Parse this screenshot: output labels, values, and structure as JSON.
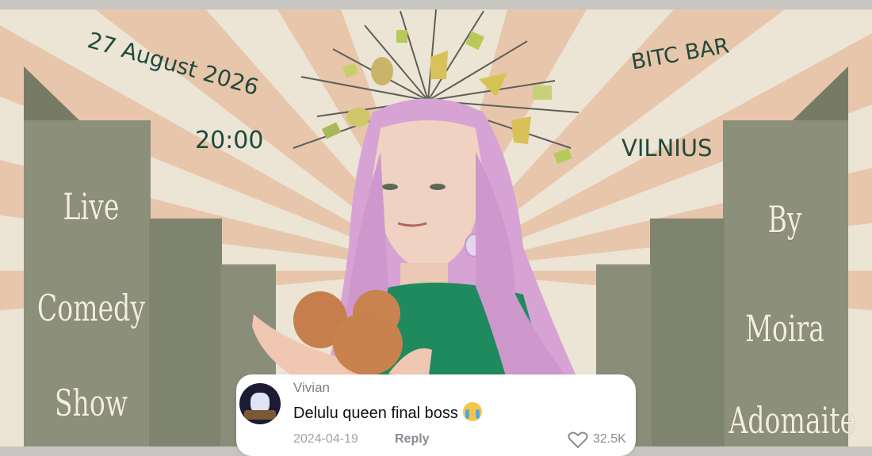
{
  "poster": {
    "date": "27 August 2026",
    "time": "20:00",
    "venue": "BITC BAR",
    "city": "VILNIUS",
    "left_words": [
      "Live",
      "Comedy",
      "Show"
    ],
    "right_words": [
      "By",
      "Moira",
      "Adomaite"
    ]
  },
  "comment": {
    "username": "Vivian",
    "text": "Delulu queen final boss",
    "emoji": "loudly-crying-face",
    "date": "2024-04-19",
    "reply_label": "Reply",
    "like_count": "32.5K"
  },
  "colors": {
    "poster_text": "#1f4a3c",
    "tall_text": "#f3ecdf",
    "building": "#8a8e77",
    "ray": "#e6c7ae",
    "hair": "#d9a6d6",
    "shirt": "#1f8a5e",
    "egg": "#c9814f"
  }
}
